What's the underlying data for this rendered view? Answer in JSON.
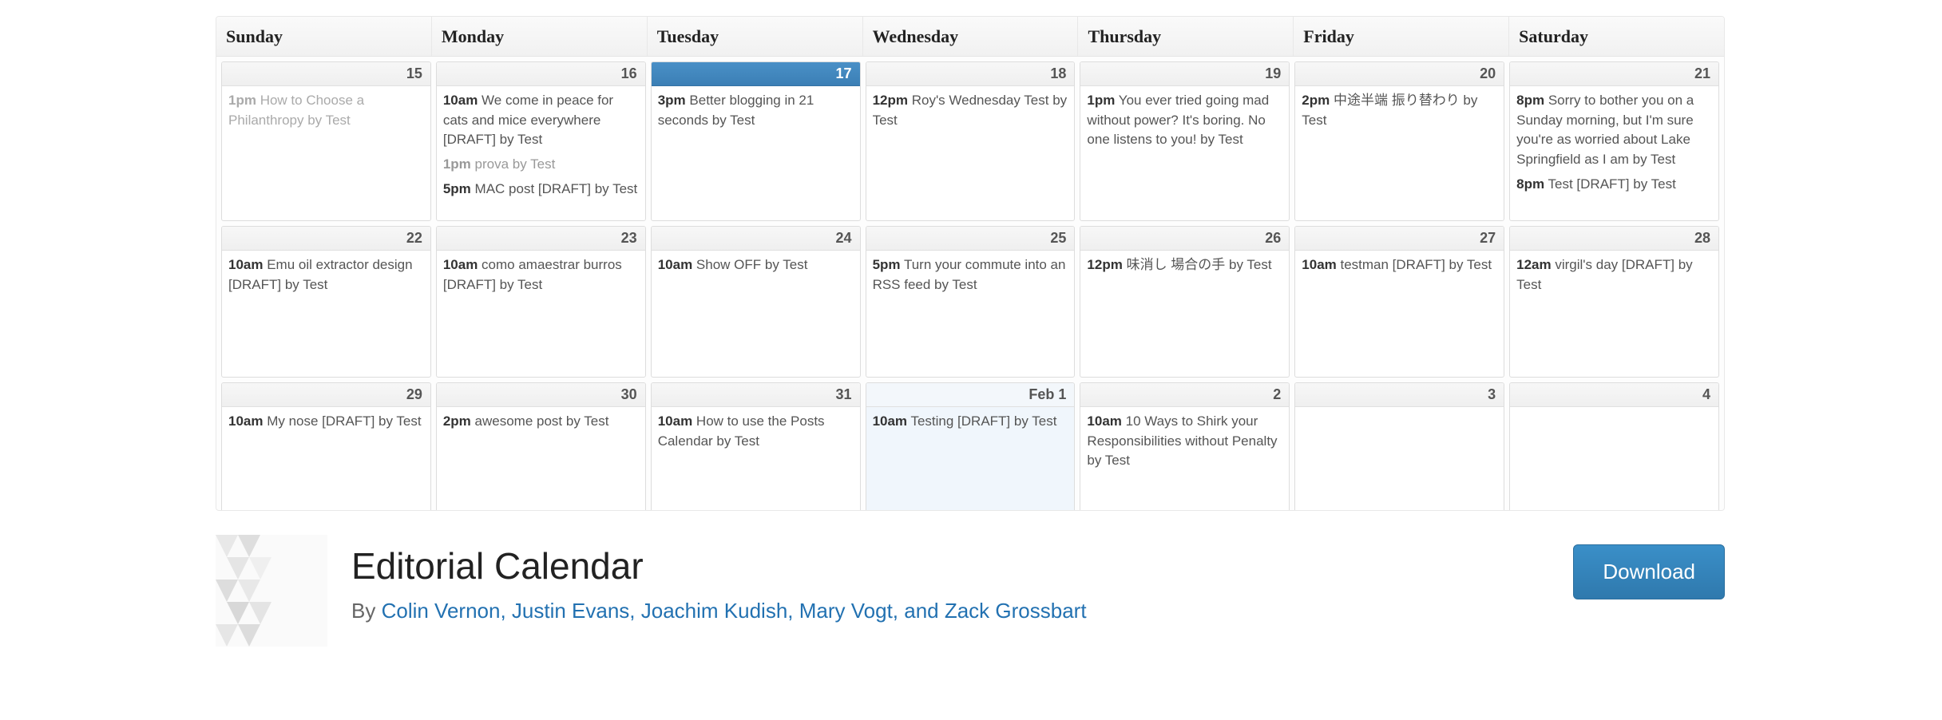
{
  "calendar": {
    "days": [
      "Sunday",
      "Monday",
      "Tuesday",
      "Wednesday",
      "Thursday",
      "Friday",
      "Saturday"
    ],
    "weeks": [
      [
        {
          "date": "15",
          "entries": [
            {
              "time": "1pm",
              "text": "How to Choose a Philanthropy by Test",
              "past": true
            }
          ]
        },
        {
          "date": "16",
          "entries": [
            {
              "time": "10am",
              "text": "We come in peace for cats and mice everywhere [DRAFT] by Test"
            },
            {
              "time": "1pm",
              "text": "prova by Test",
              "dimmed": true
            },
            {
              "time": "5pm",
              "text": "MAC post [DRAFT] by Test"
            }
          ]
        },
        {
          "date": "17",
          "today": true,
          "entries": [
            {
              "time": "3pm",
              "text": "Better blogging in 21 seconds by Test"
            }
          ]
        },
        {
          "date": "18",
          "entries": [
            {
              "time": "12pm",
              "text": "Roy's Wednesday Test by Test"
            }
          ]
        },
        {
          "date": "19",
          "entries": [
            {
              "time": "1pm",
              "text": "You ever tried going mad without power? It's boring. No one listens to you! by Test"
            }
          ]
        },
        {
          "date": "20",
          "entries": [
            {
              "time": "2pm",
              "text": "中途半端 振り替わり by Test"
            }
          ]
        },
        {
          "date": "21",
          "entries": [
            {
              "time": "8pm",
              "text": "Sorry to bother you on a Sunday morning, but I'm sure you're as worried about Lake Springfield as I am by Test"
            },
            {
              "time": "8pm",
              "text": "Test [DRAFT] by Test"
            }
          ]
        }
      ],
      [
        {
          "date": "22",
          "entries": [
            {
              "time": "10am",
              "text": "Emu oil extractor design [DRAFT] by Test"
            }
          ]
        },
        {
          "date": "23",
          "entries": [
            {
              "time": "10am",
              "text": "como amaestrar burros [DRAFT] by Test"
            }
          ]
        },
        {
          "date": "24",
          "entries": [
            {
              "time": "10am",
              "text": "Show OFF by Test"
            }
          ]
        },
        {
          "date": "25",
          "entries": [
            {
              "time": "5pm",
              "text": "Turn your commute into an RSS feed by Test"
            }
          ]
        },
        {
          "date": "26",
          "entries": [
            {
              "time": "12pm",
              "text": "味消し 場合の手 by Test"
            }
          ]
        },
        {
          "date": "27",
          "entries": [
            {
              "time": "10am",
              "text": "testman [DRAFT] by Test"
            }
          ]
        },
        {
          "date": "28",
          "entries": [
            {
              "time": "12am",
              "text": "virgil's day [DRAFT] by Test"
            }
          ]
        }
      ],
      [
        {
          "date": "29",
          "entries": [
            {
              "time": "10am",
              "text": "My nose [DRAFT] by Test"
            }
          ]
        },
        {
          "date": "30",
          "entries": [
            {
              "time": "2pm",
              "text": "awesome post by Test"
            }
          ]
        },
        {
          "date": "31",
          "entries": [
            {
              "time": "10am",
              "text": "How to use the Posts Calendar by Test"
            }
          ]
        },
        {
          "date": "Feb 1",
          "next": true,
          "entries": [
            {
              "time": "10am",
              "text": "Testing [DRAFT] by Test"
            }
          ]
        },
        {
          "date": "2",
          "entries": [
            {
              "time": "10am",
              "text": "10 Ways to Shirk your Responsibilities without Penalty by Test"
            }
          ]
        },
        {
          "date": "3",
          "entries": []
        },
        {
          "date": "4",
          "entries": []
        }
      ]
    ]
  },
  "plugin": {
    "title": "Editorial Calendar",
    "by_label": "By ",
    "authors": "Colin Vernon, Justin Evans, Joachim Kudish, Mary Vogt, and Zack Grossbart",
    "download_label": "Download"
  }
}
